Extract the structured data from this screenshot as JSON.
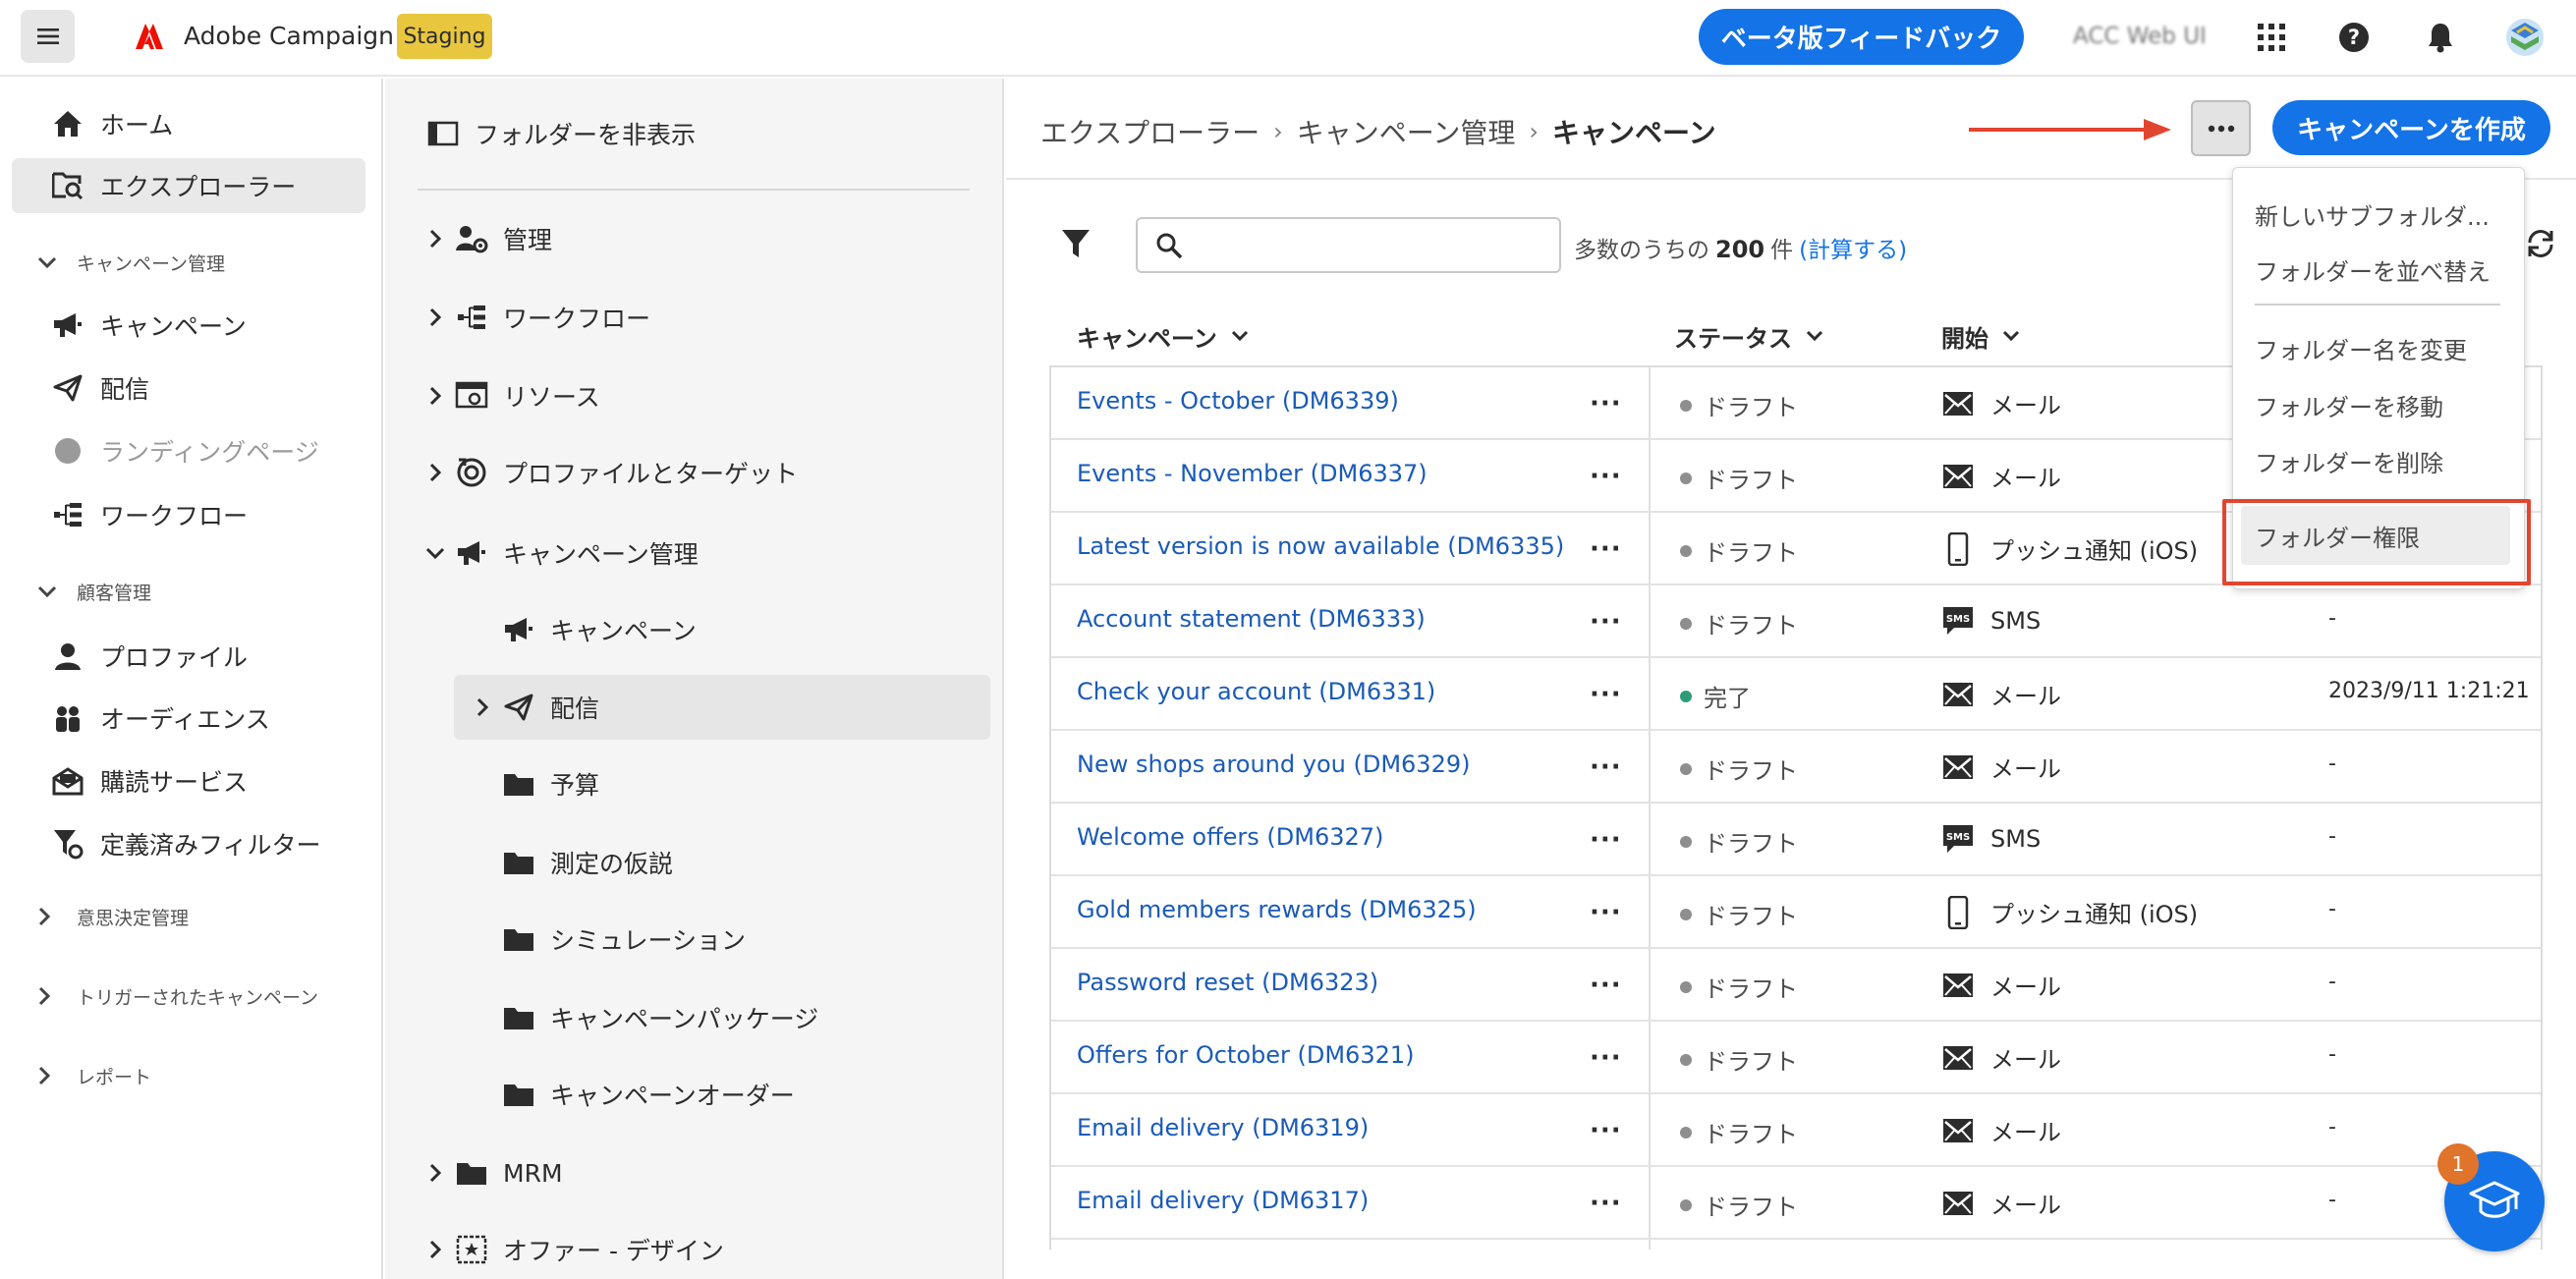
{
  "topbar": {
    "app_title": "Adobe Campaign",
    "env_badge": "Staging",
    "beta_feedback": "ベータ版フィードバック",
    "org_name": "ACC Web UI"
  },
  "leftnav": {
    "home": "ホーム",
    "explorer": "エクスプローラー",
    "campaign_mgmt_section": "キャンペーン管理",
    "campaigns": "キャンペーン",
    "deliveries": "配信",
    "landing_pages": "ランディングページ",
    "workflows": "ワークフロー",
    "customer_mgmt_section": "顧客管理",
    "profiles": "プロファイル",
    "audiences": "オーディエンス",
    "subscriptions": "購読サービス",
    "predefined_filters": "定義済みフィルター",
    "decisioning_section": "意思決定管理",
    "triggered_section": "トリガーされたキャンペーン",
    "reports_section": "レポート"
  },
  "folders": {
    "hide_label": "フォルダーを非表示",
    "items": [
      {
        "label": "管理",
        "icon": "admin-icon"
      },
      {
        "label": "ワークフロー",
        "icon": "workflow-icon"
      },
      {
        "label": "リソース",
        "icon": "resources-icon"
      },
      {
        "label": "プロファイルとターゲット",
        "icon": "target-icon"
      },
      {
        "label": "キャンペーン管理",
        "icon": "megaphone-icon"
      },
      {
        "label": "キャンペーン",
        "icon": "megaphone-icon"
      },
      {
        "label": "配信",
        "icon": "send-icon"
      },
      {
        "label": "予算",
        "icon": "folder-icon"
      },
      {
        "label": "測定の仮説",
        "icon": "folder-icon"
      },
      {
        "label": "シミュレーション",
        "icon": "folder-icon"
      },
      {
        "label": "キャンペーンパッケージ",
        "icon": "folder-icon"
      },
      {
        "label": "キャンペーンオーダー",
        "icon": "folder-icon"
      },
      {
        "label": "MRM",
        "icon": "folder-icon"
      },
      {
        "label": "オファー - デザイン",
        "icon": "offer-icon"
      }
    ]
  },
  "main": {
    "breadcrumb": [
      "エクスプローラー",
      "キャンペーン管理",
      "キャンペーン"
    ],
    "create_button": "キャンペーンを作成",
    "search_placeholder": "",
    "count_prefix": "多数のうちの",
    "count_value": "200",
    "count_suffix": "件",
    "count_link": "(計算する)",
    "columns": [
      "キャンペーン",
      "ステータス",
      "開始"
    ],
    "rows": [
      {
        "name": "Events - October (DM6339)",
        "status": "ドラフト",
        "channel": "メール",
        "channel_icon": "mail-icon",
        "extra": ""
      },
      {
        "name": "Events - November (DM6337)",
        "status": "ドラフト",
        "channel": "メール",
        "channel_icon": "mail-icon",
        "extra": ""
      },
      {
        "name": "Latest version is now available (DM6335)",
        "status": "ドラフト",
        "channel": "プッシュ通知 (iOS)",
        "channel_icon": "mobile-icon",
        "extra": ""
      },
      {
        "name": "Account statement (DM6333)",
        "status": "ドラフト",
        "channel": "SMS",
        "channel_icon": "sms-icon",
        "extra": "-"
      },
      {
        "name": "Check your account (DM6331)",
        "status": "完了",
        "channel": "メール",
        "channel_icon": "mail-icon",
        "extra": "2023/9/11 1:21:21"
      },
      {
        "name": "New shops around you (DM6329)",
        "status": "ドラフト",
        "channel": "メール",
        "channel_icon": "mail-icon",
        "extra": "-"
      },
      {
        "name": "Welcome offers (DM6327)",
        "status": "ドラフト",
        "channel": "SMS",
        "channel_icon": "sms-icon",
        "extra": "-"
      },
      {
        "name": "Gold members rewards (DM6325)",
        "status": "ドラフト",
        "channel": "プッシュ通知 (iOS)",
        "channel_icon": "mobile-icon",
        "extra": "-"
      },
      {
        "name": "Password reset (DM6323)",
        "status": "ドラフト",
        "channel": "メール",
        "channel_icon": "mail-icon",
        "extra": "-"
      },
      {
        "name": "Offers for October (DM6321)",
        "status": "ドラフト",
        "channel": "メール",
        "channel_icon": "mail-icon",
        "extra": "-"
      },
      {
        "name": "Email delivery (DM6319)",
        "status": "ドラフト",
        "channel": "メール",
        "channel_icon": "mail-icon",
        "extra": "-"
      },
      {
        "name": "Email delivery (DM6317)",
        "status": "ドラフト",
        "channel": "メール",
        "channel_icon": "mail-icon",
        "extra": "-"
      }
    ]
  },
  "menu": {
    "new_subfolder": "新しいサブフォルダ...",
    "sort_folders": "フォルダーを並べ替え",
    "rename_folder": "フォルダー名を変更",
    "move_folder": "フォルダーを移動",
    "delete_folder": "フォルダーを削除",
    "folder_permissions": "フォルダー権限"
  },
  "help": {
    "badge": "1"
  },
  "colors": {
    "accent": "#1473e6",
    "staging": "#e8c63e",
    "annotation": "#e2452f",
    "status_done": "#2d9d78",
    "status_draft": "#8e8e8e"
  }
}
